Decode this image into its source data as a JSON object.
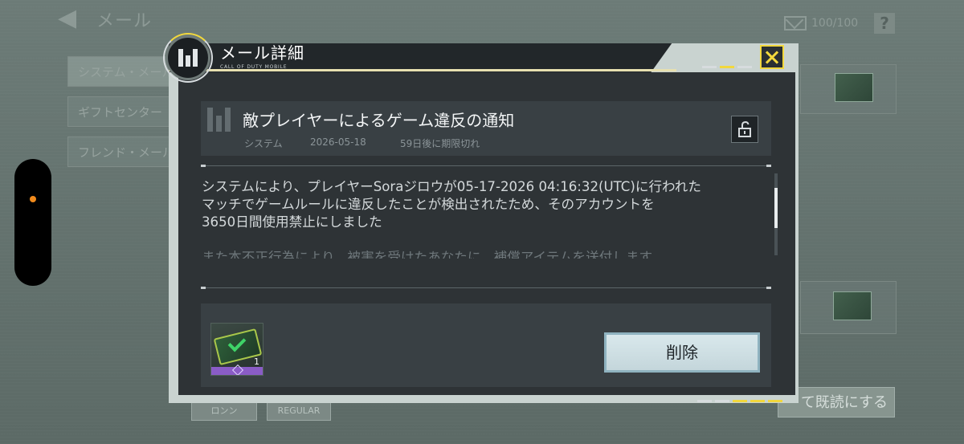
{
  "background": {
    "title": "メール",
    "mail_count": "100/100",
    "help_label": "?",
    "tabs": [
      "システム・メール",
      "ギフトセンター",
      "フレンド・メール"
    ],
    "read_all_label": "て既読にする",
    "bottom_buttons": [
      "ロンン",
      "REGULAR"
    ]
  },
  "dialog": {
    "title": "メール詳細",
    "subtitle": "CALL OF DUTY MOBILE",
    "mail": {
      "title": "敵プレイヤーによるゲーム違反の通知",
      "sender": "システム",
      "date": "2026-05-18",
      "expiry": "59日後に期限切れ",
      "body_lines": [
        "システムにより、プレイヤーSoraジロウが05-17-2026 04:16:32(UTC)に行われた",
        "マッチでゲームルールに違反したことが検出されたため、そのアカウントを",
        "3650日間使用禁止にしました"
      ],
      "body_faded": "また本不正行為により、被害を受けたあなたに、補償アイテムを送付します"
    },
    "attachment": {
      "quantity": "1",
      "rarity_color": "#8a5cc6"
    },
    "delete_label": "削除"
  },
  "colors": {
    "accent": "#f2d83d",
    "panel": "#2e3336",
    "card": "#394044"
  }
}
